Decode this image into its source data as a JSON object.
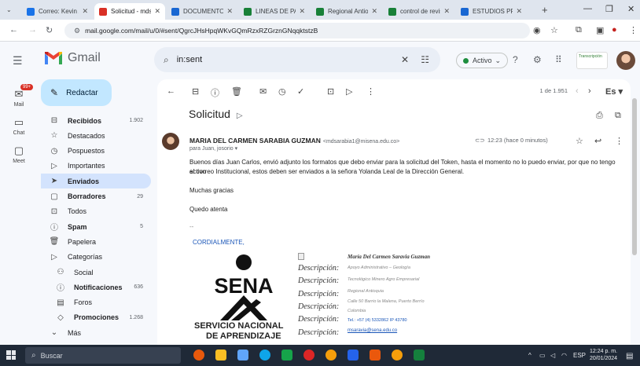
{
  "browser": {
    "tabs": [
      {
        "label": "Correo: Kevin A",
        "fav": "#1a73e8"
      },
      {
        "label": "Solicitud - mdsa",
        "fav": "#d93025",
        "active": true
      },
      {
        "label": "DOCUMENTOS",
        "fav": "#1967d2"
      },
      {
        "label": "LINEAS DE PAA",
        "fav": "#188038"
      },
      {
        "label": "Regional Antioq",
        "fav": "#188038"
      },
      {
        "label": "control de revis",
        "fav": "#188038"
      },
      {
        "label": "ESTUDIOS PREV",
        "fav": "#1967d2"
      }
    ],
    "url": "mail.google.com/mail/u/0/#sent/QgrcJHsHpqWKvGQmRzxRZGrznGNqqktstzB"
  },
  "gmail": {
    "logo_text": "Gmail",
    "search_value": "in:sent",
    "status_label": "Activo",
    "brand_chip_text": "Transcripción",
    "compose_label": "Redactar",
    "rail": [
      {
        "label": "Mail",
        "badge": "99+"
      },
      {
        "label": "Chat"
      },
      {
        "label": "Meet"
      }
    ],
    "folders": [
      {
        "label": "Recibidos",
        "count": "1.902",
        "bold": true
      },
      {
        "label": "Destacados",
        "count": ""
      },
      {
        "label": "Pospuestos",
        "count": ""
      },
      {
        "label": "Importantes",
        "count": ""
      },
      {
        "label": "Enviados",
        "count": "",
        "bold": true,
        "selected": true
      },
      {
        "label": "Borradores",
        "count": "29",
        "bold": true
      },
      {
        "label": "Todos",
        "count": ""
      },
      {
        "label": "Spam",
        "count": "5",
        "bold": true
      },
      {
        "label": "Papelera",
        "count": ""
      },
      {
        "label": "Categorías",
        "count": ""
      },
      {
        "label": "Social",
        "count": "",
        "sub": true
      },
      {
        "label": "Notificaciones",
        "count": "636",
        "bold": true,
        "sub": true
      },
      {
        "label": "Foros",
        "count": "",
        "sub": true
      },
      {
        "label": "Promociones",
        "count": "1.268",
        "bold": true,
        "sub": true
      },
      {
        "label": "Más",
        "count": ""
      }
    ]
  },
  "message": {
    "pager": "1 de 1.951",
    "lang": "Es",
    "subject": "Solicitud",
    "sender_name": "MARIA DEL CARMEN SARABIA GUZMAN",
    "sender_email": "<mdsarabia1@misena.edu.co>",
    "recipients": "para Juan, josorio",
    "time": "12:23 (hace 0 minutos)",
    "body_line_1": "Buenos días Juan Carlos, envió adjunto los formatos que debo enviar para la solicitud del Token, hasta el momento no lo puedo enviar, por que no tengo activo",
    "body_line_2": "el correo Institucional, estos deben ser enviados a la señora Yolanda Leal de la Dirección General.",
    "thanks": "Muchas gracias",
    "closing": "Quedo atenta",
    "dash": "--",
    "cordial": "CORDIALMENTE,",
    "signature": {
      "org_line_1": "SERVICIO NACIONAL",
      "org_line_2": "DE APRENDIZAJE",
      "logo_text": "SENA",
      "desc_label": "Descripción:",
      "name": "María Del Carmen Saravia Guzman",
      "role": "Apoyo Administrativo – Geología",
      "center": "Tecnológico Minero Agro Empresarial",
      "regional": "Regional Antioquia",
      "address": "Calle 50 Barrio la Malena, Puerto Berrío",
      "country": "Colombia",
      "tel": "Tel.: +57 (4) 5332862  IP 43780",
      "email": "msaravia@sena.edu.co"
    }
  },
  "taskbar": {
    "search_label": "Buscar",
    "lang": "ESP",
    "time": "12:24 p. m.",
    "date": "20/01/2024"
  }
}
